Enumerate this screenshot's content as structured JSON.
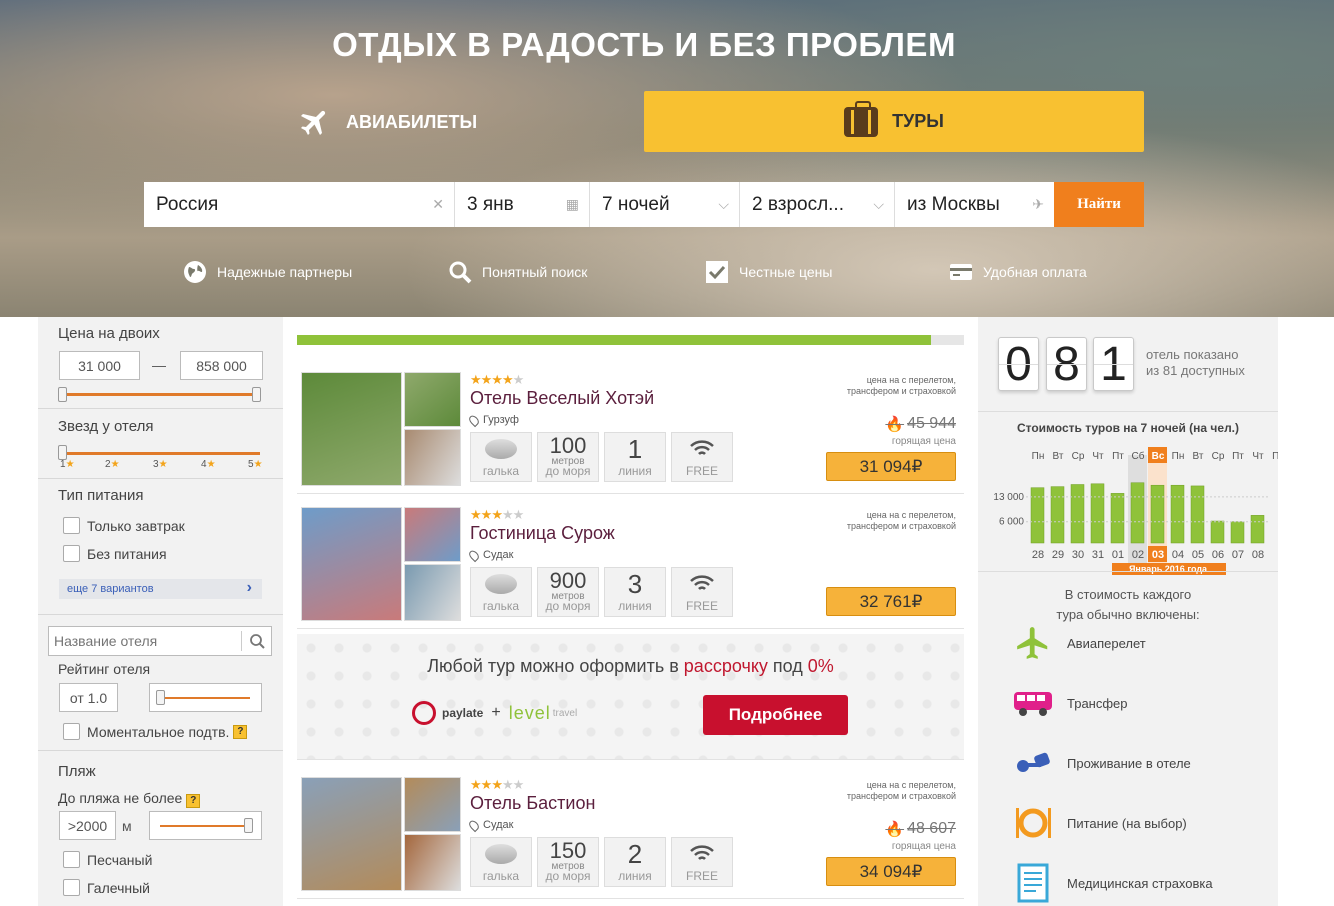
{
  "hero": {
    "title": "ОТДЫХ В РАДОСТЬ И БЕЗ ПРОБЛЕМ",
    "tab_avia": "АВИАБИЛЕТЫ",
    "tab_tours": "ТУРЫ"
  },
  "search": {
    "country": "Россия",
    "date": "3 янв",
    "nights": "7 ночей",
    "guests": "2 взросл...",
    "from": "из Москвы",
    "find_label": "Найти"
  },
  "features": [
    "Надежные партнеры",
    "Понятный поиск",
    "Честные цены",
    "Удобная оплата"
  ],
  "filters": {
    "price_title": "Цена на двоих",
    "price_min": "31 000",
    "price_dash": "—",
    "price_max": "858 000",
    "stars_title": "Звезд у отеля",
    "stars_ticks": [
      "1",
      "2",
      "3",
      "4",
      "5"
    ],
    "food_title": "Тип питания",
    "food_options": [
      "Только завтрак",
      "Без питания"
    ],
    "food_more": "еще 7 вариантов",
    "hotel_name_placeholder": "Название отеля",
    "rating_title": "Рейтинг отеля",
    "rating_value": "от 1.0",
    "instant_label": "Моментальное подтв.",
    "help_mark": "?",
    "beach_title": "Пляж",
    "beach_distance_label": "До пляжа не более",
    "beach_distance_value": ">2000",
    "beach_unit": "м",
    "beach_options": [
      "Песчаный",
      "Галечный"
    ]
  },
  "progress": {
    "fraction": 0.95
  },
  "hotels": [
    {
      "name": "Отель Веселый Хотэй",
      "stars": 4,
      "city": "Гурзуф",
      "beach": "галька",
      "distance": "100",
      "distance_unit": "метров",
      "distance_label": "до моря",
      "line": "1",
      "line_label": "линия",
      "wifi": "FREE",
      "price_note": "цена на с перелетом,\nтрансфером и страховкой",
      "old_price": "45 944",
      "hot_label": "горящая цена",
      "price": "31 094₽"
    },
    {
      "name": "Гостиница Сурож",
      "stars": 3,
      "city": "Судак",
      "beach": "галька",
      "distance": "900",
      "distance_unit": "метров",
      "distance_label": "до моря",
      "line": "3",
      "line_label": "линия",
      "wifi": "FREE",
      "price_note": "цена на с перелетом,\nтрансфером и страховкой",
      "old_price": "",
      "hot_label": "",
      "price": "32 761₽"
    },
    {
      "name": "Отель Бастион",
      "stars": 3,
      "city": "Судак",
      "beach": "галька",
      "distance": "150",
      "distance_unit": "метров",
      "distance_label": "до моря",
      "line": "2",
      "line_label": "линия",
      "wifi": "FREE",
      "price_note": "цена на с перелетом,\nтрансфером и страховкой",
      "old_price": "48 607",
      "hot_label": "горящая цена",
      "price": "34 094₽"
    }
  ],
  "promo": {
    "text_before": "Любой тур можно оформить в ",
    "text_red": "рассрочку",
    "text_mid": " под ",
    "text_pct": "0%",
    "button": "Подробнее",
    "logo1": "paylate",
    "plus": "+",
    "logo2": "level",
    "logo2_suffix": "travel"
  },
  "counter": {
    "digits": [
      "0",
      "8",
      "1"
    ],
    "caption_line1": "отель показано",
    "caption_line2": "из 81 доступных"
  },
  "chart_data": {
    "type": "bar",
    "title": "Стоимость туров на 7 ночей (на чел.)",
    "weekdays": [
      "Пн",
      "Вт",
      "Ср",
      "Чт",
      "Пт",
      "Сб",
      "Вс",
      "Пн",
      "Вт",
      "Ср",
      "Пт",
      "Чт",
      "Пт"
    ],
    "categories": [
      "28",
      "29",
      "30",
      "31",
      "01",
      "02",
      "03",
      "04",
      "05",
      "06",
      "07",
      "08"
    ],
    "values": [
      15600,
      15900,
      16500,
      16700,
      14000,
      17000,
      16300,
      16300,
      16100,
      6200,
      6000,
      7800
    ],
    "yticks": [
      "13 000",
      "6 000"
    ],
    "ylim": [
      0,
      22000
    ],
    "highlight_index": 6,
    "weekend_indices": [
      5,
      6
    ],
    "period_label": "Январь 2016 года",
    "colors": {
      "bar": "#8fc23a",
      "highlight": "#f07f1d",
      "weekend": "#d4d4d4"
    }
  },
  "included": {
    "title_line1": "В стоимость каждого",
    "title_line2": "тура обычно включены:",
    "items": [
      {
        "label": "Авиаперелет",
        "icon": "plane-icon",
        "color": "#8fc23a"
      },
      {
        "label": "Трансфер",
        "icon": "bus-icon",
        "color": "#e0208a"
      },
      {
        "label": "Проживание в отеле",
        "icon": "keys-icon",
        "color": "#3a5fb8"
      },
      {
        "label": "Питание (на выбор)",
        "icon": "plate-icon",
        "color": "#f39a1f"
      },
      {
        "label": "Медицинская страховка",
        "icon": "document-icon",
        "color": "#39a8d8"
      }
    ]
  }
}
